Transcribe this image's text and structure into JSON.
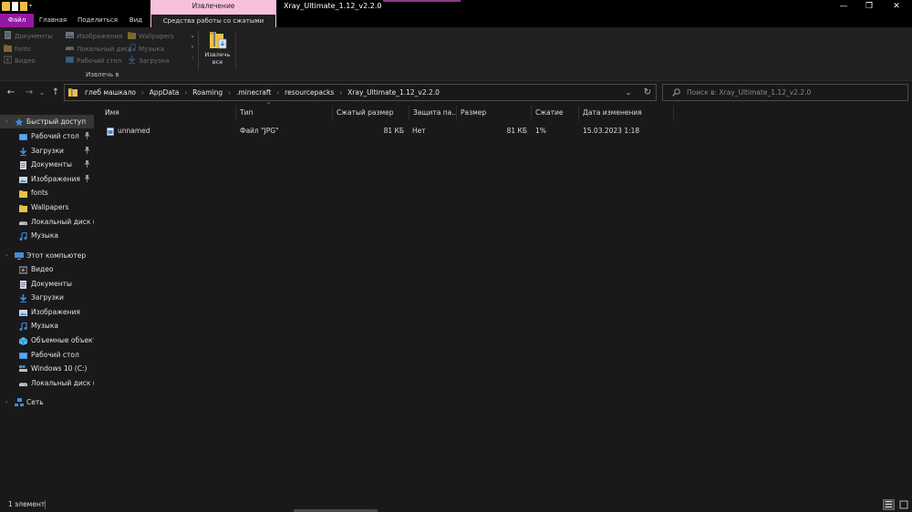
{
  "window": {
    "title": "Xray_Ultimate_1.12_v2.2.0",
    "context_group": "Извлечение",
    "minimize": "—",
    "maximize": "❐",
    "close": "✕"
  },
  "tabs": {
    "file": "Файл",
    "home": "Главная",
    "share": "Поделиться",
    "view": "Вид",
    "compressed_tools": "Средства работы со сжатыми папками"
  },
  "ribbon": {
    "gallery": [
      {
        "label": "Документы",
        "icon": "document-icon"
      },
      {
        "label": "Изображения",
        "icon": "pictures-icon"
      },
      {
        "label": "Wallpapers",
        "icon": "folder-icon"
      },
      {
        "label": "fonts",
        "icon": "folder-icon"
      },
      {
        "label": "Локальный диск",
        "icon": "drive-icon"
      },
      {
        "label": "Музыка",
        "icon": "music-icon"
      },
      {
        "label": "Видео",
        "icon": "video-icon"
      },
      {
        "label": "Рабочий стол",
        "icon": "desktop-icon"
      },
      {
        "label": "Загрузки",
        "icon": "downloads-icon"
      }
    ],
    "gallery_scroll": [
      "▴",
      "▾",
      "▿"
    ],
    "extract_all_line1": "Извлечь",
    "extract_all_line2": "все",
    "group_label": "Извлечь в"
  },
  "nav": {
    "back": "←",
    "forward": "→",
    "recent": "⌄",
    "up": "↑"
  },
  "address": {
    "crumbs": [
      "глеб машкало",
      "AppData",
      "Roaming",
      ".minecraft",
      "resourcepacks",
      "Xray_Ultimate_1.12_v2.2.0"
    ],
    "separator": "›",
    "dropdown": "⌄",
    "refresh": "↻"
  },
  "search": {
    "placeholder": "Поиск в: Xray_Ultimate_1.12_v2.2.0"
  },
  "navpane": {
    "quick_access": "Быстрый доступ",
    "quick_items": [
      {
        "label": "Рабочий стол",
        "pinned": true,
        "icon": "desktop-icon"
      },
      {
        "label": "Загрузки",
        "pinned": true,
        "icon": "downloads-icon"
      },
      {
        "label": "Документы",
        "pinned": true,
        "icon": "document-icon"
      },
      {
        "label": "Изображения",
        "pinned": true,
        "icon": "pictures-icon"
      },
      {
        "label": "fonts",
        "pinned": false,
        "icon": "folder-icon"
      },
      {
        "label": "Wallpapers",
        "pinned": false,
        "icon": "folder-icon"
      },
      {
        "label": "Локальный диск (D",
        "pinned": false,
        "icon": "drive-icon"
      },
      {
        "label": "Музыка",
        "pinned": false,
        "icon": "music-icon"
      }
    ],
    "this_pc": "Этот компьютер",
    "pc_items": [
      {
        "label": "Видео",
        "icon": "video-icon"
      },
      {
        "label": "Документы",
        "icon": "document-icon"
      },
      {
        "label": "Загрузки",
        "icon": "downloads-icon"
      },
      {
        "label": "Изображения",
        "icon": "pictures-icon"
      },
      {
        "label": "Музыка",
        "icon": "music-icon"
      },
      {
        "label": "Объемные объекты",
        "icon": "3d-objects-icon"
      },
      {
        "label": "Рабочий стол",
        "icon": "desktop-icon"
      },
      {
        "label": "Windows 10 (C:)",
        "icon": "windows-drive-icon"
      },
      {
        "label": "Локальный диск (D",
        "icon": "drive-icon"
      }
    ],
    "network": "Сеть",
    "pin_glyph": "📌"
  },
  "columns": {
    "name": "Имя",
    "type": "Тип",
    "compressed_size": "Сжатый размер",
    "protection": "Защита па...",
    "size": "Размер",
    "ratio": "Сжатие",
    "modified": "Дата изменения",
    "sort_glyph": "^"
  },
  "files": [
    {
      "name": "unnamed",
      "type": "Файл \"JPG\"",
      "compressed_size": "81 КБ",
      "protection": "Нет",
      "size": "81 КБ",
      "ratio": "1%",
      "modified": "15.03.2023 1:18"
    }
  ],
  "status": {
    "count": "1 элемент"
  },
  "colors": {
    "accent_file_tab": "#9717a4",
    "context_tab": "#f7c0dd",
    "background": "#191919",
    "folder_yellow": "#e8c14a",
    "blue": "#3b8fe0"
  }
}
